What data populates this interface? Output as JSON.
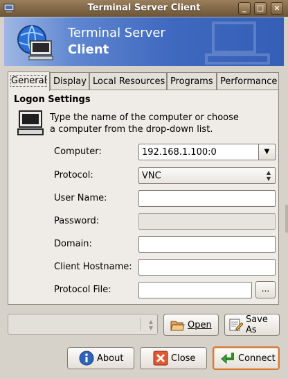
{
  "window": {
    "title": "Terminal Server Client",
    "buttons": {
      "minimize": "_",
      "maximize": "□",
      "close": "×"
    }
  },
  "banner": {
    "line1": "Terminal Server",
    "line2": "Client"
  },
  "tabs": [
    {
      "label": "General",
      "active": true
    },
    {
      "label": "Display",
      "active": false
    },
    {
      "label": "Local Resources",
      "active": false
    },
    {
      "label": "Programs",
      "active": false
    },
    {
      "label": "Performance",
      "active": false
    }
  ],
  "logon": {
    "section_title": "Logon Settings",
    "instructions_line1": "Type the name of the computer or choose",
    "instructions_line2": "a computer from the drop-down list.",
    "fields": {
      "computer": {
        "label": "Computer:",
        "value": "192.168.1.100:0"
      },
      "protocol": {
        "label": "Protocol:",
        "value": "VNC"
      },
      "username": {
        "label": "User Name:",
        "value": ""
      },
      "password": {
        "label": "Password:",
        "value": ""
      },
      "domain": {
        "label": "Domain:",
        "value": ""
      },
      "client_hostname": {
        "label": "Client Hostname:",
        "value": ""
      },
      "protocol_file": {
        "label": "Protocol File:",
        "value": "",
        "browse_label": "..."
      }
    }
  },
  "profile": {
    "selected": ""
  },
  "buttons": {
    "open": "Open",
    "save_as": "Save As",
    "about": "About",
    "close": "Close",
    "connect": "Connect"
  },
  "icons": {
    "app": "monitor-icon",
    "banner": "terminal-globe-icon",
    "computer": "computer-icon",
    "open": "folder-open-icon",
    "save_as": "save-as-icon",
    "about": "info-icon",
    "close": "close-icon",
    "connect": "connect-arrow-icon"
  },
  "colors": {
    "titlebar": "#7b6140",
    "banner": "#3f68bf",
    "default_button_border": "#d0793a"
  }
}
